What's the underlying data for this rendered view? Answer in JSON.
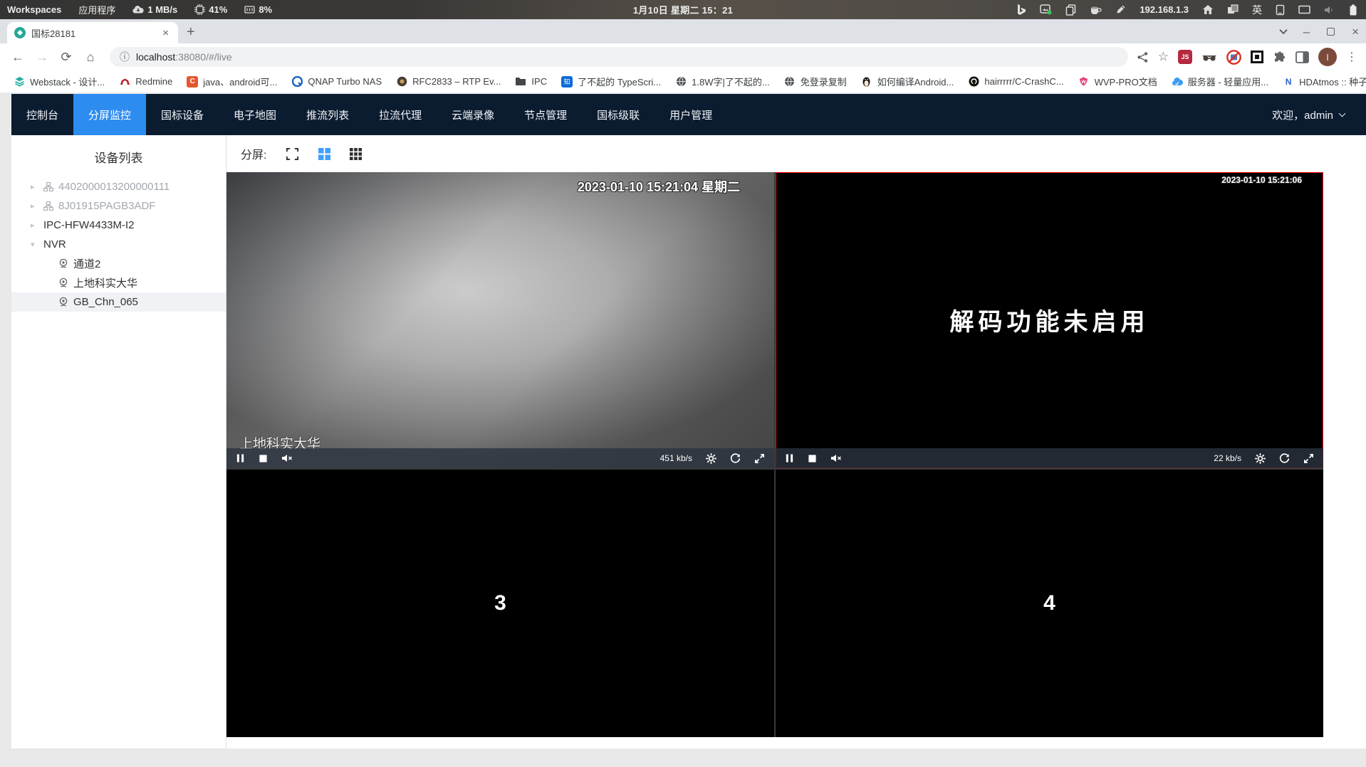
{
  "colors": {
    "nav_bg": "#0c1c30",
    "nav_active": "#2d8cf0",
    "grid_icon_blue": "#409eff",
    "selected_cell_border": "#ff0000",
    "favicon_teal": "#26a69a"
  },
  "system_bar": {
    "workspaces": "Workspaces",
    "applications": "应用程序",
    "net_speed": "1 MB/s",
    "cpu_usage": "41%",
    "mem_usage": "8%",
    "clock": "1月10日 星期二 15：21",
    "ip_address": "192.168.1.3",
    "ime": "英"
  },
  "browser": {
    "tab_title": "国标28181",
    "url_host": "localhost",
    "url_rest": ":38080/#/live",
    "js_badge": "JS",
    "avatar_initial": "I",
    "zhihu_glyph": "知",
    "c_glyph": "C",
    "wvp_glyph": "W",
    "n_glyph": "N",
    "bookmarks": [
      {
        "label": "Webstack - 设计..."
      },
      {
        "label": "Redmine"
      },
      {
        "label": "java、android可..."
      },
      {
        "label": "QNAP Turbo NAS"
      },
      {
        "label": "RFC2833 – RTP Ev..."
      },
      {
        "label": "IPC"
      },
      {
        "label": "了不起的 TypeScri..."
      },
      {
        "label": "1.8W字|了不起的..."
      },
      {
        "label": "免登录复制"
      },
      {
        "label": "如何编译Android..."
      },
      {
        "label": "hairrrrr/C-CrashC..."
      },
      {
        "label": "WVP-PRO文档"
      },
      {
        "label": "服务器 - 轻量应用..."
      },
      {
        "label": "HDAtmos :: 种子 *..."
      }
    ],
    "bookmarks_overflow": "»"
  },
  "app": {
    "nav_items": [
      "控制台",
      "分屏监控",
      "国标设备",
      "电子地图",
      "推流列表",
      "拉流代理",
      "云端录像",
      "节点管理",
      "国标级联",
      "用户管理"
    ],
    "welcome": "欢迎，admin",
    "sidebar_title": "设备列表",
    "tree": [
      {
        "label": "4402000013200000111"
      },
      {
        "label": "8J01915PAGB3ADF"
      },
      {
        "label": "IPC-HFW4433M-I2"
      },
      {
        "label": "NVR"
      },
      {
        "label": "通道2"
      },
      {
        "label": "上地科实大华"
      },
      {
        "label": "GB_Chn_065"
      }
    ],
    "toolbar": {
      "split_label": "分屏:"
    },
    "players": [
      {
        "osd_time": "2023-01-10 15:21:04 星期二",
        "overlay_name": "上地科实大华",
        "bitrate": "451 kb/s"
      },
      {
        "osd_time": "2023-01-10 15:21:06",
        "message": "解码功能未启用",
        "bitrate": "22 kb/s"
      },
      {
        "placeholder": "3"
      },
      {
        "placeholder": "4"
      }
    ]
  },
  "icons": {
    "back": "←",
    "forward": "→",
    "reload": "⟳",
    "home": "⌂",
    "info": "ⓘ",
    "star": "☆",
    "menu": "⋮",
    "close": "×",
    "new_tab": "+",
    "minimize": "–",
    "caret_collapsed": "▸",
    "caret_expanded": "▾"
  }
}
